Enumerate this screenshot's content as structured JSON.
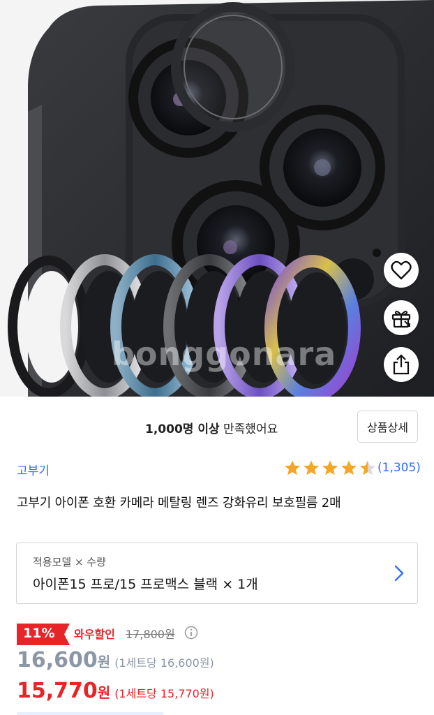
{
  "hero": {
    "watermark": "bonggonara",
    "actions": [
      {
        "name": "heart-icon"
      },
      {
        "name": "gift-icon"
      },
      {
        "name": "share-icon"
      }
    ]
  },
  "satisfaction": {
    "count": "1,000명 이상",
    "text": " 만족했어요",
    "detail_button": "상품상세"
  },
  "product": {
    "brand": "고부기",
    "rating": 4.5,
    "rating_max": 5,
    "review_count": "(1,305)",
    "title": "고부기 아이폰 호환 카메라 메탈링 렌즈 강화유리 보호필름 2매"
  },
  "option": {
    "label": "적용모델 × 수량",
    "value": "아이폰15 프로/15 프로맥스 블랙 × 1개"
  },
  "price": {
    "discount_rate": "11%",
    "discount_label": "와우할인",
    "original_price": "17,800원",
    "sale_price": "16,600",
    "sale_unit": "원",
    "sale_per": "(1세트당 16,600원)",
    "wow_price": "15,770",
    "wow_unit": "원",
    "wow_per": "(1세트당 15,770원)"
  },
  "colors": {
    "accent_blue": "#346aff",
    "wow_red": "#e52528",
    "star": "#f5a623",
    "gray_price": "#8c96a5"
  }
}
